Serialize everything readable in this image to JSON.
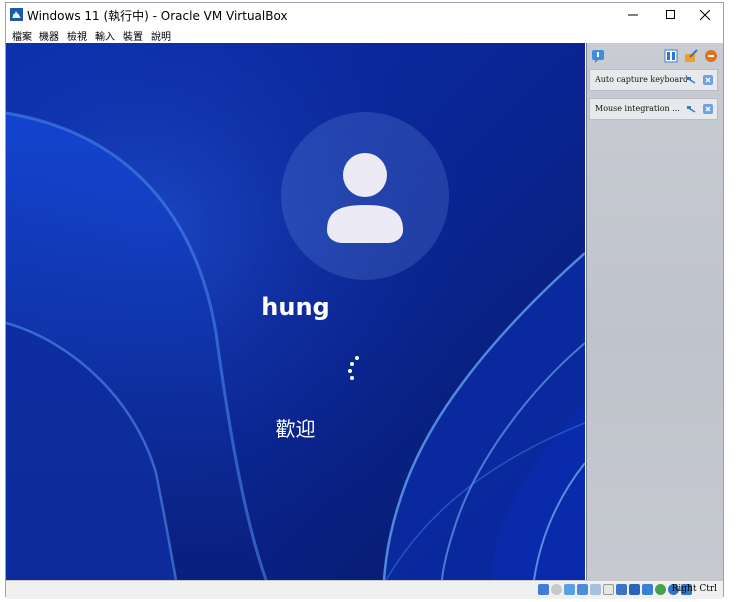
{
  "window": {
    "title": "Windows 11 (執行中) - Oracle VM VirtualBox"
  },
  "menu": {
    "items": [
      "檔案",
      "機器",
      "檢視",
      "輸入",
      "裝置",
      "說明"
    ]
  },
  "guest": {
    "username": "hung",
    "status_text": "歡迎",
    "accent": "#0a2a9c"
  },
  "side_panel": {
    "notices": [
      {
        "text": "Auto capture keyboard ..."
      },
      {
        "text": "Mouse integration ..."
      }
    ]
  },
  "status_bar": {
    "host_key": "Right Ctrl",
    "icons": [
      "hard-disk-icon",
      "optical-drive-icon",
      "audio-icon",
      "network-icon",
      "usb-icon",
      "shared-folders-icon",
      "display-icon",
      "video-capture-icon",
      "recording-icon",
      "cpu-icon",
      "mouse-integration-icon",
      "keyboard-capture-icon"
    ]
  }
}
